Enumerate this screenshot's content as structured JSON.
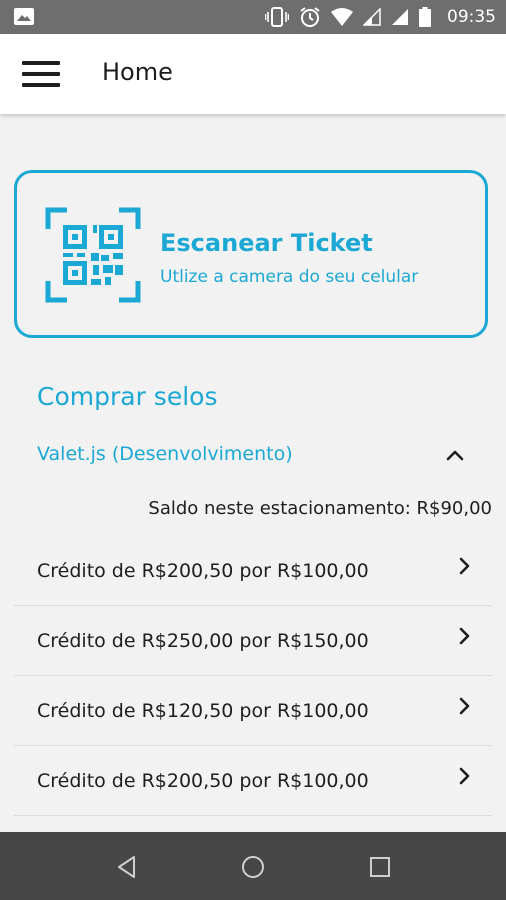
{
  "status_bar": {
    "time": "09:35",
    "icons": [
      "image-icon",
      "vibrate-icon",
      "alarm-icon",
      "wifi-icon",
      "signal-icon",
      "signal-icon",
      "battery-icon"
    ]
  },
  "app_bar": {
    "menu_icon": "menu-icon",
    "title": "Home"
  },
  "scan_card": {
    "icon": "qr-code-icon",
    "title": "Escanear Ticket",
    "subtitle": "Utlize a camera do seu celular"
  },
  "section": {
    "title": "Comprar selos"
  },
  "parking": {
    "name": "Valet.js (Desenvolvimento)",
    "expanded": true,
    "balance_text": "Saldo neste estacionamento: R$90,00"
  },
  "offers": [
    {
      "label": "Crédito de R$200,50 por R$100,00"
    },
    {
      "label": "Crédito de R$250,00 por R$150,00"
    },
    {
      "label": "Crédito de R$120,50 por R$100,00"
    },
    {
      "label": "Crédito de R$200,50 por R$100,00"
    }
  ],
  "nav_bar": {
    "buttons": [
      "back-icon",
      "home-icon",
      "recents-icon"
    ]
  },
  "colors": {
    "accent": "#1ba8d4",
    "status_bar": "#6e6e6e",
    "nav_bar": "#474747",
    "background": "#f2f2f2"
  }
}
